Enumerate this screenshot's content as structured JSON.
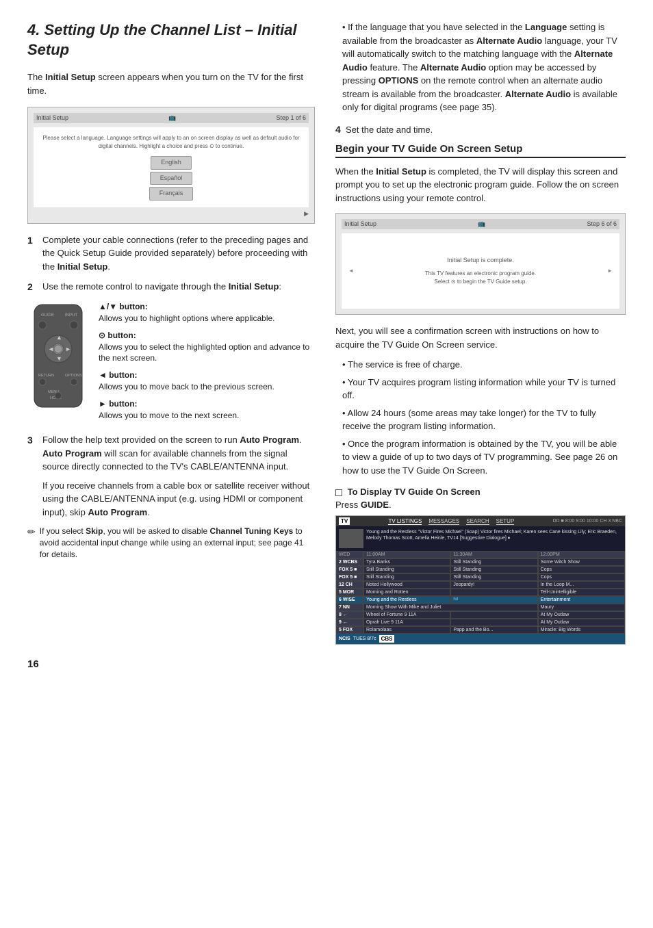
{
  "page": {
    "title": "4. Setting Up the Channel List – Initial Setup",
    "number": "16",
    "intro": "The Initial Setup screen appears when you turn on the TV for the first time."
  },
  "left_column": {
    "initial_setup_screen": {
      "header_left": "Initial Setup",
      "header_right": "Step 1 of 6",
      "body_text": "Please select a language. Language settings will apply to an on screen display as well as default audio for digital channels. Highlight a choice and press  to continue.",
      "languages": [
        "English",
        "Español",
        "Français"
      ]
    },
    "steps": [
      {
        "num": "1",
        "text_before": "Complete your cable connections (refer to the preceding pages and the Quick Setup Guide provided separately) before proceeding with the ",
        "bold": "Initial Setup",
        "text_after": "."
      },
      {
        "num": "2",
        "text_before": "Use the remote control to navigate through the ",
        "bold": "Initial Setup",
        "text_after": ":"
      }
    ],
    "buttons": [
      {
        "label": "▲/▼ button:",
        "desc": "Allows you to highlight options where applicable."
      },
      {
        "label": "⊙ button:",
        "desc": "Allows you to select the highlighted option and advance to the next screen."
      },
      {
        "label": "◄ button:",
        "desc": "Allows you to move back to the previous screen."
      },
      {
        "label": "► button:",
        "desc": "Allows you to move to the next screen."
      }
    ],
    "step3": {
      "num": "3",
      "text": "Follow the help text provided on the screen to run Auto Program. Auto Program will scan for available channels from the signal source directly connected to the TV's CABLE/ANTENNA input.",
      "text2": "If you receive channels from a cable box or satellite receiver without using the CABLE/ANTENNA input (e.g. using HDMI or component input), skip Auto Program."
    },
    "note": {
      "text": "If you select Skip, you will be asked to disable Channel Tuning Keys to avoid accidental input change while using an external input; see page 41 for details."
    }
  },
  "right_column": {
    "bullet_points": [
      "If the language that you have selected in the Language setting is available from the broadcaster as Alternate Audio language, your TV will automatically switch to the matching language with the Alternate Audio feature. The Alternate Audio option may be accessed by pressing OPTIONS on the remote control when an alternate audio stream is available from the broadcaster. Alternate Audio is available only for digital programs (see page 35).",
      "Set the date and time."
    ],
    "section_title": "Begin your TV Guide On Screen Setup",
    "section_intro": "When the Initial Setup is completed, the TV will display this screen and prompt you to set up the electronic program guide. Follow the on screen instructions using your remote control.",
    "step6_screen": {
      "header_left": "Initial Setup",
      "header_right": "Step 6 of 6",
      "body_line1": "Initial Setup is complete.",
      "body_line2": "This TV features an electronic program guide.",
      "body_line3": "Select  to begin the TV Guide setup."
    },
    "next_text": "Next, you will see a confirmation screen with instructions on how to acquire the TV Guide On Screen service.",
    "confirmation_bullets": [
      "The service is free of charge.",
      "Your TV acquires program listing information while your TV is turned off.",
      "Allow 24 hours (some areas may take longer) for the TV to fully receive the program listing information.",
      "Once the program information is obtained by the TV, you will be able to view a guide of up to two days of TV programming. See page 26 on how to use the TV Guide On Screen."
    ],
    "to_display_title": "To Display TV Guide On Screen",
    "to_display_text": "Press GUIDE.",
    "tv_guide": {
      "tabs": [
        "TV LISTINGS",
        "MESSAGES",
        "SEARCH",
        "SETUP"
      ],
      "desc": "Young and the Restless \"Victor Fires Michael\" (Soap) Victor fires Michael; Karen sees Cane kissing Lily; Eric Braeden, Melody Thomas Scott, Amelia Heinle, TV14 [Suggestive Dialogue] ♦",
      "times": [
        "11:00AM",
        "11:30AM",
        "12:00PM"
      ],
      "rows": [
        {
          "chan": "2 WCBS",
          "c1": "Tyra Banks",
          "c2": "Still Standing",
          "c3": "Some Witch Show"
        },
        {
          "chan": "FOX 5",
          "c1": "Still Standing",
          "c2": "Still Standing",
          "c3": "Cops"
        },
        {
          "chan": "FOX 5",
          "c1": "Still Standing",
          "c2": "Still Standing",
          "c3": "Cops"
        },
        {
          "chan": "12 CH",
          "c1": "Noted Hollywood",
          "c2": "Jeopardy!",
          "c3": "In the Loop M..."
        },
        {
          "chan": "5 MOR",
          "c1": "Morning and Rotten",
          "c2": "",
          "c3": "Tell-Unintelligible"
        },
        {
          "chan": "6 WISE",
          "c1": "Young and the Restless",
          "c2": "hd",
          "c3": "Entertainment"
        },
        {
          "chan": "7 NN",
          "c1": "Morning Show With Mike and Juliet",
          "c2": "Maury",
          "c3": ""
        },
        {
          "chan": "8 ←",
          "c1": "Wheel of Fortune 9 11A",
          "c2": "",
          "c3": "At My Outlaw"
        },
        {
          "chan": "9 ←",
          "c1": "Oprah Live 9 11A",
          "c2": "",
          "c3": "At My Outlaw"
        },
        {
          "chan": "5 FOX",
          "c1": "Rolamolaas",
          "c2": "Papp and the Bo...",
          "c3": "Miracle: Big Words"
        }
      ],
      "bottom_left": "NCIS",
      "bottom_date": "TUES 8/7c",
      "bottom_logo": "CBS"
    }
  }
}
